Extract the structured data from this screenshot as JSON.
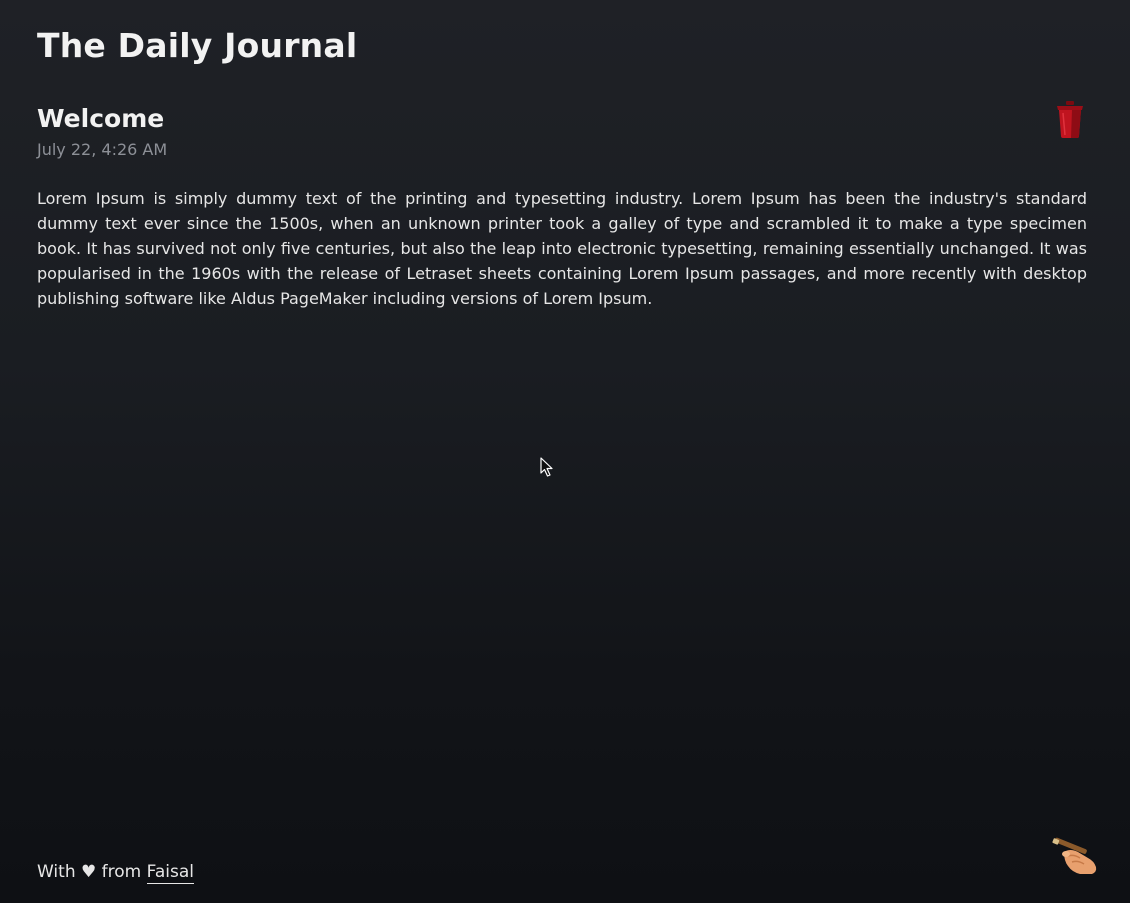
{
  "app": {
    "title": "The Daily Journal"
  },
  "entry": {
    "title": "Welcome",
    "date": "July 22, 4:26 AM",
    "body": "Lorem Ipsum is simply dummy text of the printing and typesetting industry. Lorem Ipsum has been the industry's standard dummy text ever since the 1500s, when an unknown printer took a galley of type and scrambled it to make a type specimen book. It has survived not only five centuries, but also the leap into electronic typesetting, remaining essentially unchanged. It was popularised in the 1960s with the release of Letraset sheets containing Lorem Ipsum passages, and more recently with desktop publishing software like Aldus PageMaker including versions of Lorem Ipsum.",
    "delete_icon": "trash-icon"
  },
  "footer": {
    "prefix": "With",
    "heart": "♥",
    "middle": "from",
    "author": "Faisal"
  },
  "compose": {
    "icon": "writing-hand-icon"
  },
  "colors": {
    "background_top": "#1f2126",
    "background_bottom": "#0e1014",
    "text": "#e6e6e6",
    "muted": "#8d9097",
    "trash_red": "#c0141f"
  }
}
